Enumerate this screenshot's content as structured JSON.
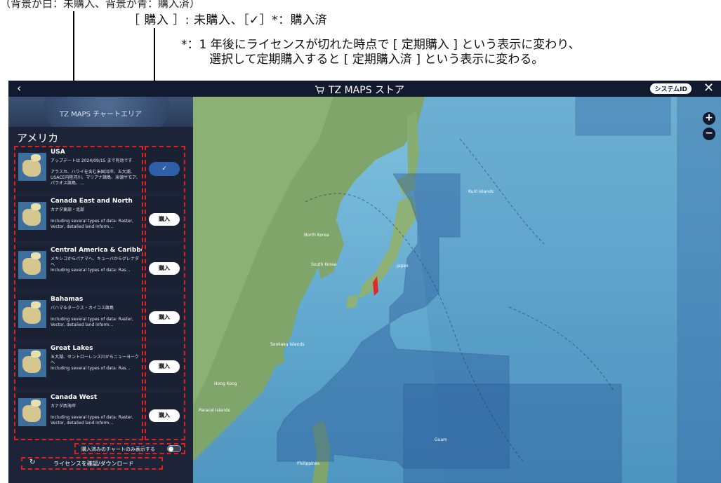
{
  "annotations": {
    "top_partial": "（背景が白：未購入、背景が青：購入済）",
    "buy_states": "［ 購入 ］: 未購入、［✓］*：購入済",
    "note_line1": "*：1 年後にライセンスが切れた時点で [ 定期購入 ] という表示に変わり、",
    "note_line2": "選択して定期購入すると [ 定期購入済 ] という表示に変わる。"
  },
  "titlebar": {
    "back_icon": "chevron-left-icon",
    "title": "TZ MAPS ストア",
    "cart_icon": "cart-icon",
    "system_id": "システムID",
    "close_icon": "close-icon"
  },
  "sidebar": {
    "banner_label": "TZ MAPS チャートエリア",
    "region": "アメリカ",
    "items": [
      {
        "name": "USA",
        "line1": "アップデートは 2024/09/15 まで有効です",
        "line2": "アラスカ、ハワイを含む米国沿岸、五大湖、USACE内陸河川、マリアナ諸島、米領サモア、パラオス諸島、…",
        "state": "purchased",
        "button": "✓"
      },
      {
        "name": "Canada East and North",
        "line1": "カナダ東部・北部",
        "line2": "Including several types of data: Raster, Vector, detailed land inform...",
        "state": "buy",
        "button": "購入"
      },
      {
        "name": "Central America & Caribbean",
        "line1": "メキシコからパナマへ、キューバからグレナダへ",
        "line2": "Including several types of data: Ras...",
        "state": "buy",
        "button": "購入"
      },
      {
        "name": "Bahamas",
        "line1": "バハマ＆タークス・カイコス諸島",
        "line2": "Including several types of data: Raster, Vector, detailed land inform...",
        "state": "buy",
        "button": "購入"
      },
      {
        "name": "Great Lakes",
        "line1": "五大湖、セントローレンス川からニューヨークへ",
        "line2": "Including several types of data: Ras...",
        "state": "buy",
        "button": "購入"
      },
      {
        "name": "Canada West",
        "line1": "カナダ西海岸",
        "line2": "Including several types of data: Raster, Vector, detailed land inform...",
        "state": "buy",
        "button": "購入"
      }
    ],
    "toggle_label": "購入済みのチャートのみ表示する",
    "license_label": "ライセンスを確認/ダウンロード",
    "license_icon": "refresh-icon"
  },
  "map": {
    "labels": {
      "kuril": "Kuril Islands",
      "north_korea": "North Korea",
      "south_korea": "South Korea",
      "japan": "Japan",
      "senkaku": "Senkaku Islands",
      "hong_kong": "Hong Kong",
      "philippines": "Philippines",
      "guam": "Guam",
      "paracel": "Paracel Islands"
    },
    "zoom_in": "+",
    "zoom_out": "−"
  },
  "colors": {
    "annotation_dash": "#e0201e",
    "purchased_button": "#2f5fa8",
    "titlebar": "#121a30"
  }
}
